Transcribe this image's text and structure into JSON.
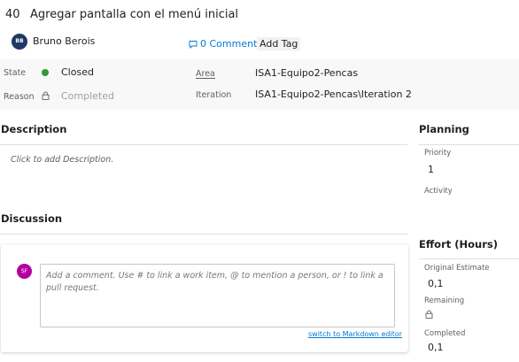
{
  "work_item": {
    "id": "40",
    "title": "Agregar pantalla con el menú inicial",
    "assignee": {
      "initials": "BB",
      "name": "Bruno Berois",
      "avatar_color": "#1f3864"
    },
    "comments_label": "0 Comments",
    "add_tag_label": "Add Tag"
  },
  "fields": {
    "state_label": "State",
    "state_value": "Closed",
    "state_color": "#339933",
    "reason_label": "Reason",
    "reason_value": "Completed",
    "area_label": "Area",
    "area_value": "ISA1-Equipo2-Pencas",
    "iteration_label": "Iteration",
    "iteration_value": "ISA1-Equipo2-Pencas\\Iteration 2"
  },
  "description": {
    "heading": "Description",
    "placeholder": "Click to add Description."
  },
  "discussion": {
    "heading": "Discussion",
    "user_initials": "SF",
    "user_avatar_color": "#b4009e",
    "comment_placeholder": "Add a comment. Use # to link a work item, @ to mention a person, or ! to link a pull request.",
    "markdown_link": "switch to Markdown editor"
  },
  "planning": {
    "heading": "Planning",
    "priority_label": "Priority",
    "priority_value": "1",
    "activity_label": "Activity"
  },
  "effort": {
    "heading": "Effort (Hours)",
    "original_estimate_label": "Original Estimate",
    "original_estimate_value": "0,1",
    "remaining_label": "Remaining",
    "completed_label": "Completed",
    "completed_value": "0,1"
  },
  "colors": {
    "accent": "#0078d4",
    "panel_bg": "#f8f8f8"
  }
}
